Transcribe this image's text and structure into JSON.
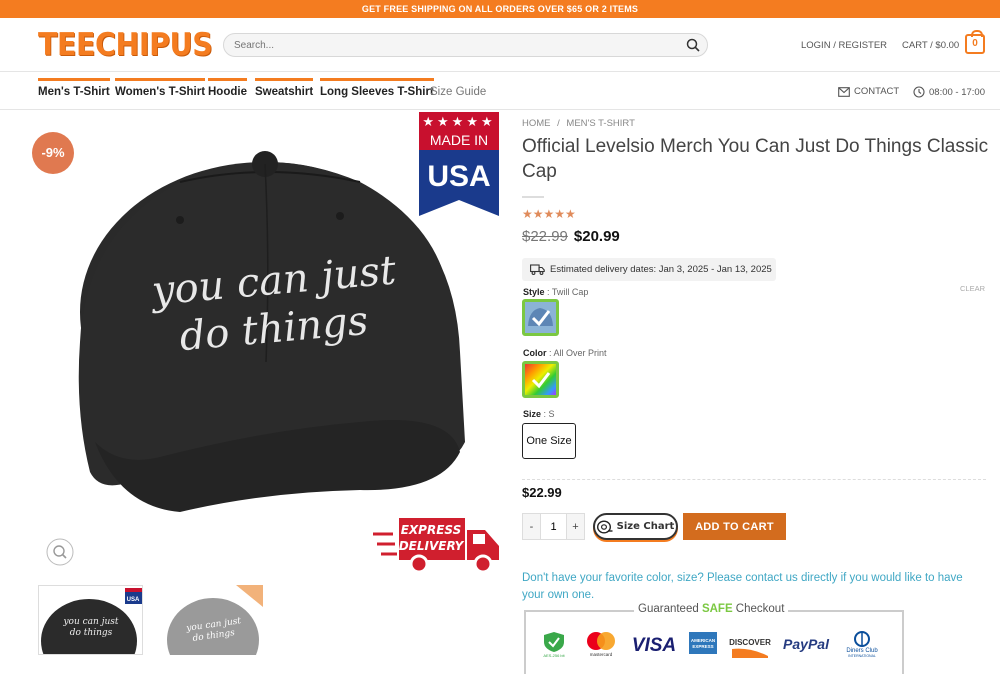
{
  "topbar": {
    "text": "GET FREE SHIPPING ON ALL ORDERS OVER $65 OR 2 ITEMS"
  },
  "header": {
    "logo": "TEECHIPUS",
    "search_placeholder": "Search...",
    "login_label": "LOGIN / REGISTER",
    "cart_label": "CART / $0.00",
    "cart_count": "0"
  },
  "nav": {
    "items": [
      "Men's T-Shirt",
      "Women's T-Shirt",
      "Hoodie",
      "Sweatshirt",
      "Long Sleeves T-Shirt",
      "Size Guide"
    ],
    "contact_label": "CONTACT",
    "hours_label": "08:00 - 17:00"
  },
  "gallery": {
    "discount_badge": "-9%",
    "made_in": "MADE IN",
    "usa": "USA",
    "cap_text_line1": "you can just",
    "cap_text_line2": "do things",
    "express_line1": "EXPRESS",
    "express_line2": "DELIVERY"
  },
  "product": {
    "breadcrumb_home": "HOME",
    "breadcrumb_sep": "/",
    "breadcrumb_category": "MEN'S T-SHIRT",
    "title": "Official Levelsio Merch You Can Just Do Things Classic Cap",
    "rating": 5,
    "stars": "★★★★★",
    "old_price": "$22.99",
    "new_price": "$20.99",
    "delivery_text": "Estimated delivery dates: Jan 3, 2025 - Jan 13, 2025",
    "style_label": "Style",
    "style_value": ": Twill Cap",
    "clear_label": "CLEAR",
    "color_label": "Color",
    "color_value": ": All Over Print",
    "size_label": "Size",
    "size_value": ": S",
    "size_option": "One Size",
    "selected_price": "$22.99",
    "qty_minus": "-",
    "qty_value": "1",
    "qty_plus": "+",
    "size_chart_label": "Size Chart",
    "add_to_cart": "ADD TO CART",
    "contact_note": "Don't have your favorite color, size? Please contact us directly if you would like to have your own one.",
    "checkout_title_pre": "Guaranteed ",
    "checkout_title_safe": "SAFE",
    "checkout_title_post": " Checkout",
    "payments": {
      "ssl": "AES-256 bit",
      "mastercard": "mastercard",
      "visa": "VISA",
      "amex_line1": "AMERICAN",
      "amex_line2": "EXPRESS",
      "discover": "DISCOVER",
      "paypal": "PayPal",
      "diners_line1": "Diners Club",
      "diners_line2": "INTERNATIONAL"
    }
  },
  "colors": {
    "accent": "#f47c20",
    "add_to_cart": "#d36c1e",
    "swatch_border": "#7bc842",
    "link": "#3fa7c4",
    "badge": "#e07950"
  }
}
